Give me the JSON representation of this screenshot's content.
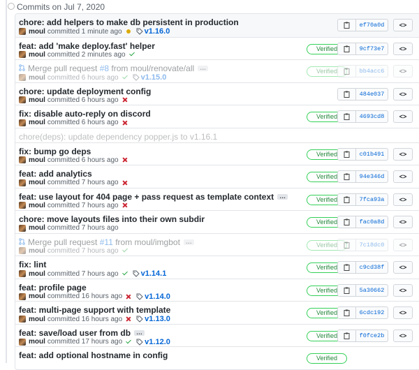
{
  "header": {
    "date_label": "Commits on Jul 7, 2020"
  },
  "commits": [
    {
      "title": "chore: add helpers to make db persistent in production",
      "author": "moul",
      "time": "committed 1 minute ago",
      "status": "pending",
      "tag": "v1.16.0",
      "verified": "",
      "sha": "ef70a0d",
      "faded": false,
      "ellipsis": false,
      "pr_prefix": "",
      "pr_number": "",
      "pr_suffix": ""
    },
    {
      "title": "feat: add 'make deploy.fast' helper",
      "author": "moul",
      "time": "committed 2 minutes ago",
      "status": "success",
      "tag": "",
      "verified": "Verified",
      "sha": "9cf73e7",
      "faded": false,
      "ellipsis": false
    },
    {
      "title": "",
      "pr_prefix": "Merge pull request ",
      "pr_number": "#8",
      "pr_suffix": " from moul/renovate/all",
      "author": "moul",
      "time": "committed 6 hours ago",
      "status": "success",
      "tag": "v1.15.0",
      "verified": "Verified",
      "sha": "bb4acc6",
      "faded": true,
      "ellipsis": true
    },
    {
      "title": "chore: update deployment config",
      "author": "moul",
      "time": "committed 6 hours ago",
      "status": "fail",
      "tag": "",
      "verified": "",
      "sha": "484e037",
      "faded": false,
      "ellipsis": false
    },
    {
      "title": "fix: disable auto-reply on discord",
      "author": "moul",
      "time": "committed 6 hours ago",
      "status": "fail",
      "tag": "",
      "verified": "Verified",
      "sha": "4693cd8",
      "faded": false,
      "ellipsis": false
    },
    {
      "only_title": true,
      "title": "chore(deps): update dependency popper.js to v1.16.1"
    },
    {
      "title": "fix: bump go deps",
      "author": "moul",
      "time": "committed 6 hours ago",
      "status": "fail",
      "tag": "",
      "verified": "Verified",
      "sha": "c01b491",
      "faded": false,
      "ellipsis": false
    },
    {
      "title": "feat: add analytics",
      "author": "moul",
      "time": "committed 7 hours ago",
      "status": "fail",
      "tag": "",
      "verified": "Verified",
      "sha": "94e346d",
      "faded": false,
      "ellipsis": false
    },
    {
      "title": "feat: use layout for 404 page + pass request as template context",
      "author": "moul",
      "time": "committed 7 hours ago",
      "status": "fail",
      "tag": "",
      "verified": "Verified",
      "sha": "7fca93a",
      "faded": false,
      "ellipsis": true
    },
    {
      "title": "chore: move layouts files into their own subdir",
      "author": "moul",
      "time": "committed 7 hours ago",
      "status": "",
      "tag": "",
      "verified": "Verified",
      "sha": "fac0a8d",
      "faded": false,
      "ellipsis": false
    },
    {
      "title": "",
      "pr_prefix": "Merge pull request ",
      "pr_number": "#11",
      "pr_suffix": " from moul/imgbot",
      "author": "moul",
      "time": "committed 7 hours ago",
      "status": "success",
      "tag": "",
      "verified": "Verified",
      "sha": "7c18dc0",
      "faded": true,
      "ellipsis": true
    },
    {
      "title": "fix: lint",
      "author": "moul",
      "time": "committed 7 hours ago",
      "status": "success",
      "tag": "v1.14.1",
      "verified": "Verified",
      "sha": "c9cd38f",
      "faded": false,
      "ellipsis": false
    },
    {
      "title": "feat: profile page",
      "author": "moul",
      "time": "committed 16 hours ago",
      "status": "fail",
      "tag": "v1.14.0",
      "verified": "Verified",
      "sha": "5a30662",
      "faded": false,
      "ellipsis": false
    },
    {
      "title": "feat: multi-page support with template",
      "author": "moul",
      "time": "committed 16 hours ago",
      "status": "fail",
      "tag": "v1.13.0",
      "verified": "Verified",
      "sha": "6cdc192",
      "faded": false,
      "ellipsis": false
    },
    {
      "title": "feat: save/load user from db",
      "author": "moul",
      "time": "committed 17 hours ago",
      "status": "success",
      "tag": "v1.12.0",
      "verified": "Verified",
      "sha": "f0fce2b",
      "faded": false,
      "ellipsis": true
    },
    {
      "title": "feat: add optional hostname in config",
      "author": "",
      "time": "",
      "status": "",
      "tag": "",
      "verified": "Verified",
      "sha": "",
      "faded": false,
      "ellipsis": false
    }
  ],
  "labels": {
    "browse": "<>"
  },
  "colors": {
    "link": "#0366d6",
    "success": "#28a745",
    "fail": "#cb2431",
    "pending": "#dbab09"
  }
}
